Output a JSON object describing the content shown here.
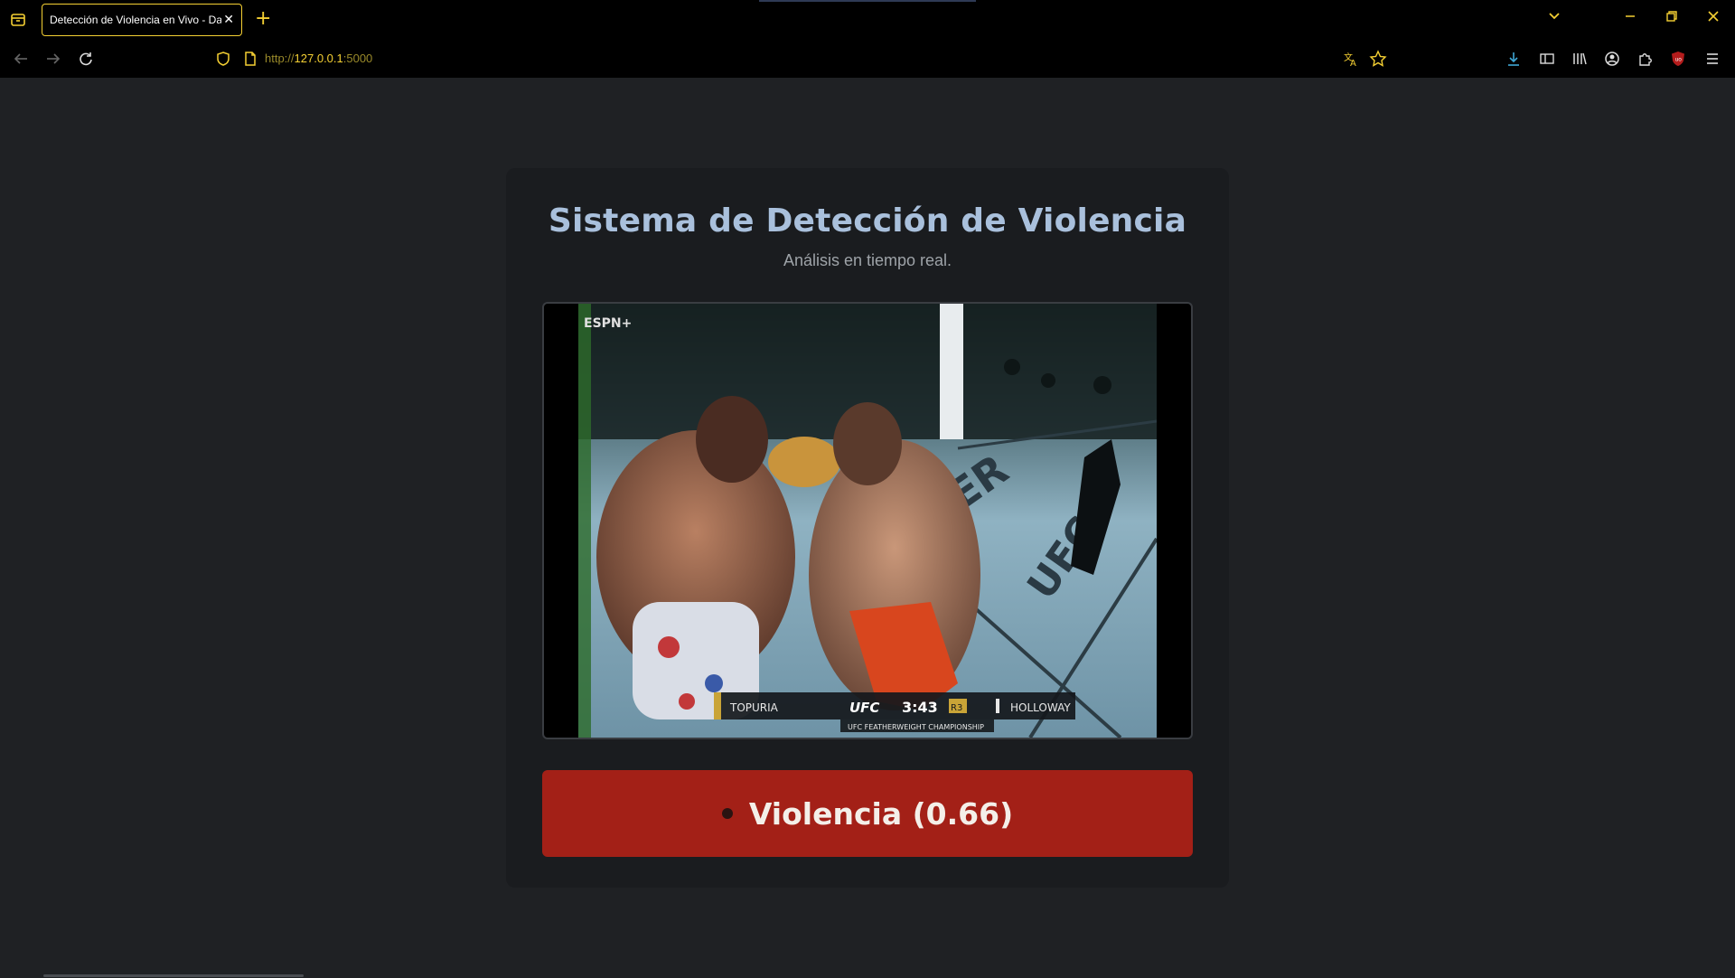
{
  "browser": {
    "tab_title": "Detección de Violencia en Vivo - Da",
    "url_prefix": "http://",
    "url_host": "127.0.0.1",
    "url_port": ":5000",
    "accent_color": "#f5d033"
  },
  "page": {
    "title": "Sistema de Detección de Violencia",
    "subtitle": "Análisis en tiempo real."
  },
  "video": {
    "overlay_left_fighter": "TOPURIA",
    "overlay_brand": "UFC",
    "overlay_clock": "3:43",
    "overlay_round": "R3",
    "overlay_right_fighter": "HOLLOWAY",
    "overlay_event": "UFC FEATHERWEIGHT CHAMPIONSHIP"
  },
  "status": {
    "label": "Violencia (0.66)",
    "color": "#a32017"
  }
}
